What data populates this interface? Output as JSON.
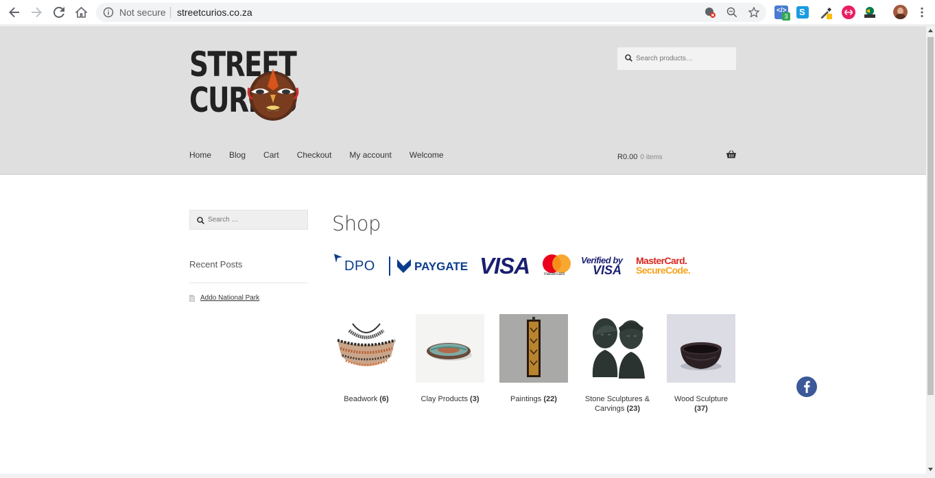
{
  "browser": {
    "security_label": "Not secure",
    "url": "streetcurios.co.za",
    "extension_badge": "3"
  },
  "site": {
    "logo_line1": "STREET",
    "logo_line2": "CURIOS",
    "search_placeholder": "Search products…",
    "nav": [
      "Home",
      "Blog",
      "Cart",
      "Checkout",
      "My account",
      "Welcome"
    ],
    "cart_amount": "R0.00",
    "cart_items": "0 items"
  },
  "sidebar": {
    "search_placeholder": "Search …",
    "recent_title": "Recent Posts",
    "recent_posts": [
      "Addo National Park"
    ]
  },
  "main": {
    "title": "Shop",
    "payment_logos": {
      "dpo": "DPO",
      "paygate": "PAYGATE",
      "visa": "VISA",
      "mastercard": "mastercard",
      "verified_by": "Verified by",
      "verified_visa": "VISA",
      "securecode_1": "MasterCard.",
      "securecode_2": "SecureCode."
    },
    "categories": [
      {
        "name": "Beadwork",
        "count": "(6)"
      },
      {
        "name": "Clay Products",
        "count": "(3)"
      },
      {
        "name": "Paintings",
        "count": "(22)"
      },
      {
        "name": "Stone Sculptures & Carvings",
        "count": "(23)"
      },
      {
        "name": "Wood Sculpture",
        "count": "(37)"
      }
    ]
  },
  "colors": {
    "header_bg": "#dfdfdf",
    "visa_blue": "#1a1f71",
    "dpo_blue": "#0b3c8c",
    "mastercard_red": "#eb001b",
    "mastercard_orange": "#f79e1b",
    "facebook": "#3b5998"
  }
}
